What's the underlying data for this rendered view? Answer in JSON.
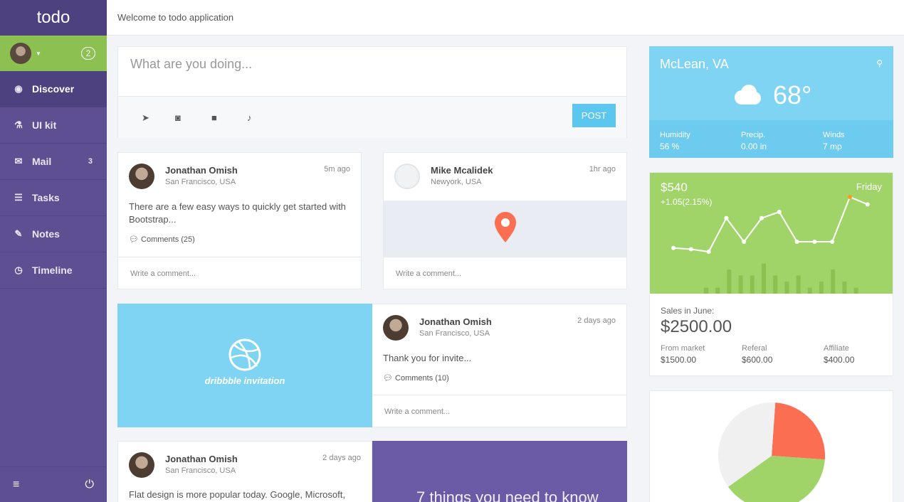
{
  "app": {
    "brand": "todo",
    "welcome": "Welcome to todo application"
  },
  "user": {
    "badge": "2"
  },
  "sidebar": {
    "items": [
      {
        "label": "Discover",
        "icon": "eye-icon"
      },
      {
        "label": "UI kit",
        "icon": "flask-icon"
      },
      {
        "label": "Mail",
        "icon": "envelope-icon",
        "count": "3"
      },
      {
        "label": "Tasks",
        "icon": "tasks-icon"
      },
      {
        "label": "Notes",
        "icon": "pencil-icon"
      },
      {
        "label": "Timeline",
        "icon": "clock-icon"
      }
    ]
  },
  "composer": {
    "placeholder": "What are you doing...",
    "post_label": "POST"
  },
  "posts": [
    {
      "name": "Jonathan Omish",
      "location": "San Francisco, USA",
      "time": "5m ago",
      "text": "There are a few easy ways to quickly get started with Bootstrap...",
      "comments": "Comments (25)",
      "write": "Write a comment..."
    },
    {
      "name": "Mike Mcalidek",
      "location": "Newyork, USA",
      "time": "1hr ago",
      "write": "Write a comment..."
    },
    {
      "name": "Jonathan Omish",
      "location": "San Francisco, USA",
      "time": "2 days ago",
      "text": "Thank you for invite...",
      "comments": "Comments (10)",
      "write": "Write a comment...",
      "invite": "dribbble invitation"
    },
    {
      "name": "Jonathan Omish",
      "location": "San Francisco, USA",
      "time": "2 days ago",
      "text": "Flat design is more popular today. Google, Microsoft,",
      "feature": "7 things you need to know"
    }
  ],
  "weather": {
    "city": "McLean, VA",
    "temp": "68°",
    "humidity_label": "Humidity",
    "humidity": "56 %",
    "precip_label": "Precip.",
    "precip": "0.00 in",
    "winds_label": "Winds",
    "winds": "7 mp"
  },
  "sales": {
    "amount": "$540",
    "change": "+1.05(2.15%)",
    "day": "Friday",
    "label": "Sales in June:",
    "total": "$2500.00",
    "market_label": "From market",
    "market": "$1500.00",
    "referal_label": "Referal",
    "referal": "$600.00",
    "affiliate_label": "Affiliate",
    "affiliate": "$400.00"
  },
  "colors": {
    "purple": "#5d4f92",
    "green": "#a0d468",
    "blue": "#7fd4f3",
    "red": "#fc6e51",
    "grey": "#f0f0f0"
  },
  "chart_data": [
    {
      "type": "line",
      "values": [
        3.1,
        3.0,
        2.8,
        5.5,
        3.6,
        5.5,
        6.0,
        3.6,
        3.6,
        3.6,
        7.2,
        6.6
      ]
    },
    {
      "type": "bar",
      "values": [
        1,
        1,
        4,
        3,
        3,
        5,
        3,
        2,
        3,
        1,
        2,
        4,
        2,
        1
      ]
    },
    {
      "type": "pie",
      "categories": [
        "red",
        "green",
        "grey"
      ],
      "values": [
        25,
        39,
        36
      ]
    }
  ]
}
